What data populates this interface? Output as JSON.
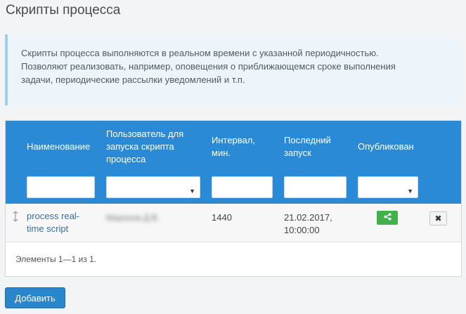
{
  "page": {
    "title": "Скрипты процесса"
  },
  "info": {
    "line1": "Скрипты процесса выполняются в реальном времени с указанной периодичностью.",
    "line2": "Позволяют реализовать, например, оповещения о приближающемся сроке выполнения",
    "line3": "задачи, периодические рассылки уведомлений и т.п."
  },
  "grid": {
    "columns": {
      "name": "Наименование",
      "user_line1": "Пользователь для",
      "user_line2": "запуска скрипта",
      "user_line3": "процесса",
      "interval_line1": "Интервал,",
      "interval_line2": "мин.",
      "last_run_line1": "Последний",
      "last_run_line2": "запуск",
      "published": "Опубликован"
    },
    "filters": {
      "name": "",
      "user": "",
      "interval": "",
      "last_run": "",
      "published": ""
    },
    "rows": [
      {
        "name_line1": "process real-",
        "name_line2": "time script",
        "user": "Миронов Д.В.",
        "interval": "1440",
        "last_run_line1": "21.02.2017,",
        "last_run_line2": "10:00:00",
        "delete_label": "✖"
      }
    ],
    "pager_info": "Элементы 1—1 из 1."
  },
  "actions": {
    "add_label": "Добавить"
  },
  "colors": {
    "header": "#2a8ad6",
    "published_button": "#43b14b",
    "add_button": "#2a86cc",
    "info_border": "#9cd0ec"
  },
  "icons": {
    "drag": "drag-handle-icon",
    "published": "share-icon",
    "delete": "close-icon",
    "dropdown": "caret-down-icon"
  }
}
